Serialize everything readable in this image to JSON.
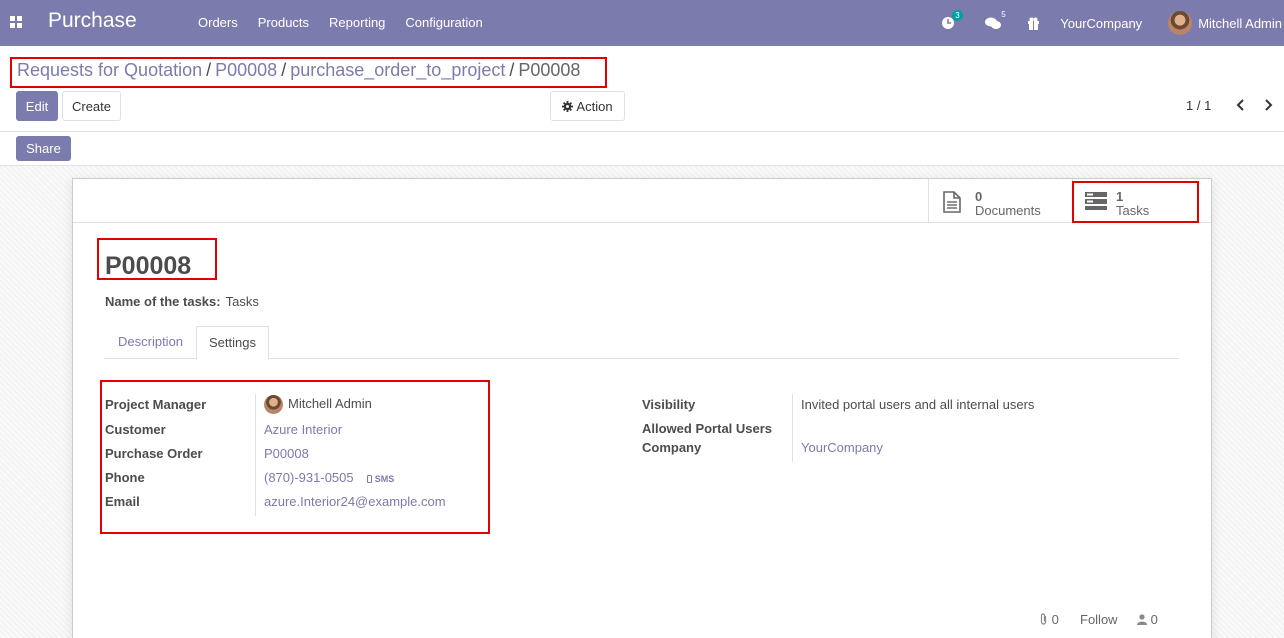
{
  "navbar": {
    "app_name": "Purchase",
    "menu": [
      "Orders",
      "Products",
      "Reporting",
      "Configuration"
    ],
    "activity_count": "3",
    "message_count": "5",
    "company": "YourCompany",
    "user": "Mitchell Admin"
  },
  "breadcrumb": {
    "items": [
      "Requests for Quotation",
      "P00008",
      "purchase_order_to_project"
    ],
    "current": "P00008"
  },
  "controls": {
    "edit": "Edit",
    "create": "Create",
    "action": "Action",
    "share": "Share",
    "pager": "1 / 1"
  },
  "stat_buttons": {
    "documents": {
      "count": "0",
      "label": "Documents"
    },
    "tasks": {
      "count": "1",
      "label": "Tasks"
    }
  },
  "record": {
    "title": "P00008",
    "name_label": "Name of the tasks:",
    "name_value": "Tasks"
  },
  "tabs": [
    "Description",
    "Settings"
  ],
  "left_group": {
    "project_manager_label": "Project Manager",
    "project_manager": "Mitchell Admin",
    "customer_label": "Customer",
    "customer": "Azure Interior",
    "purchase_order_label": "Purchase Order",
    "purchase_order": "P00008",
    "phone_label": "Phone",
    "phone": "(870)-931-0505",
    "sms": "SMS",
    "email_label": "Email",
    "email": "azure.Interior24@example.com"
  },
  "right_group": {
    "visibility_label": "Visibility",
    "visibility": "Invited portal users and all internal users",
    "allowed_label": "Allowed Portal Users",
    "company_label": "Company",
    "company": "YourCompany"
  },
  "chatter": {
    "attachments": "0",
    "follow": "Follow",
    "followers": "0"
  },
  "colors": {
    "brand": "#7c7bad",
    "highlight": "#e50000",
    "badge": "#00a09d"
  },
  "icons": [
    "apps-icon",
    "activity-clock-icon",
    "messages-icon",
    "gift-icon",
    "gear-icon",
    "chevron-left-icon",
    "chevron-right-icon",
    "document-icon",
    "tasks-icon",
    "mobile-icon",
    "paperclip-icon",
    "user-icon"
  ]
}
